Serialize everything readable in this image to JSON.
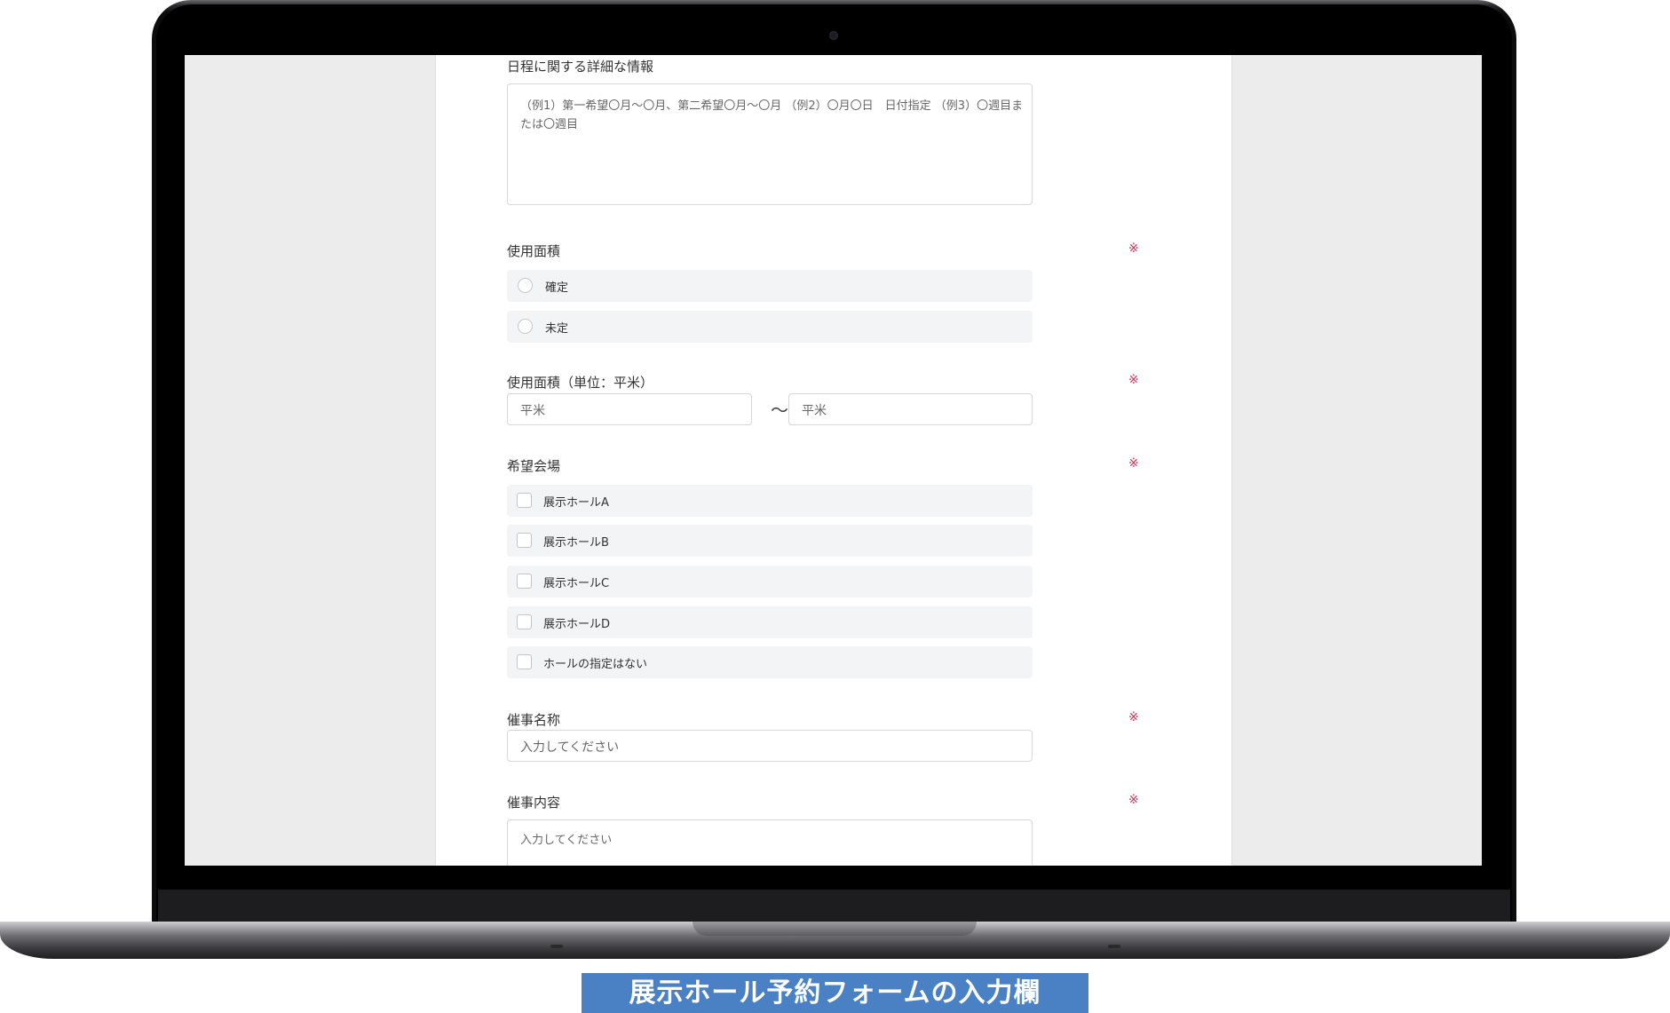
{
  "form": {
    "schedule_detail": {
      "label": "日程に関する詳細な情報",
      "placeholder": "（例1）第一希望〇月〜〇月、第二希望〇月〜〇月 （例2）〇月〇日　日付指定 （例3）〇週目または〇週目"
    },
    "area": {
      "label": "使用面積",
      "required_mark": "※",
      "options": [
        "確定",
        "未定"
      ]
    },
    "area_unit": {
      "label": "使用面積（単位：平米）",
      "required_mark": "※",
      "from_placeholder": "平米",
      "separator": "〜",
      "to_placeholder": "平米"
    },
    "venue": {
      "label": "希望会場",
      "required_mark": "※",
      "options": [
        "展示ホールA",
        "展示ホールB",
        "展示ホールC",
        "展示ホールD",
        "ホールの指定はない"
      ]
    },
    "event_name": {
      "label": "催事名称",
      "required_mark": "※",
      "placeholder": "入力してください"
    },
    "event_content": {
      "label": "催事内容",
      "required_mark": "※",
      "placeholder": "入力してください"
    }
  },
  "caption": "展示ホール予約フォームの入力欄",
  "colors": {
    "required": "#d4335a",
    "caption_bg": "#4a80c4",
    "option_bg": "#f3f4f5"
  }
}
